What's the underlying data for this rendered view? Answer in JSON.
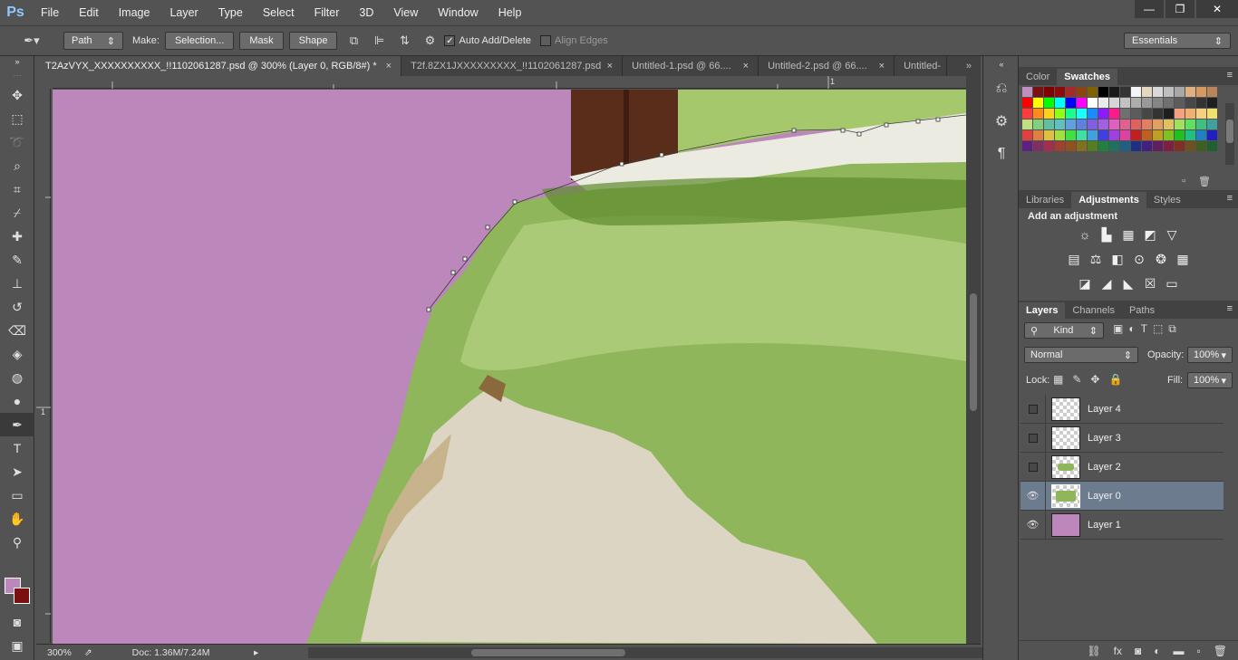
{
  "app": {
    "logo": "Ps"
  },
  "menu": [
    "File",
    "Edit",
    "Image",
    "Layer",
    "Type",
    "Select",
    "Filter",
    "3D",
    "View",
    "Window",
    "Help"
  ],
  "window_controls": {
    "minimize": "—",
    "restore": "❐",
    "close": "✕"
  },
  "options": {
    "mode_select": "Path",
    "make_label": "Make:",
    "selection_button": "Selection...",
    "mask_button": "Mask",
    "shape_button": "Shape",
    "auto_add_delete": "Auto Add/Delete",
    "align_edges": "Align Edges",
    "workspace": "Essentials"
  },
  "tabs": [
    {
      "title": "T2AzVYX_XXXXXXXXXX_!!1102061287.psd @ 300% (Layer 0, RGB/8#) *",
      "active": true
    },
    {
      "title": "T2f.8ZX1JXXXXXXXXX_!!1102061287.psd",
      "active": false
    },
    {
      "title": "Untitled-1.psd @ 66....",
      "active": false
    },
    {
      "title": "Untitled-2.psd @ 66....",
      "active": false
    },
    {
      "title": "Untitled-",
      "active": false
    }
  ],
  "rulers": {
    "top_mark": "1",
    "left_mark": "1"
  },
  "status": {
    "zoom": "300%",
    "doc": "Doc: 1.36M/7.24M"
  },
  "color_panel": {
    "tabs": [
      "Color",
      "Swatches"
    ],
    "active": "Swatches"
  },
  "adjust_panel": {
    "tabs": [
      "Libraries",
      "Adjustments",
      "Styles"
    ],
    "active": "Adjustments",
    "title": "Add an adjustment"
  },
  "layers_panel": {
    "tabs": [
      "Layers",
      "Channels",
      "Paths"
    ],
    "active": "Layers",
    "filter": "Kind",
    "blend_mode": "Normal",
    "opacity_label": "Opacity:",
    "opacity": "100%",
    "lock_label": "Lock:",
    "fill_label": "Fill:",
    "fill": "100%",
    "layers": [
      {
        "name": "Layer 4",
        "visible": false,
        "selected": false
      },
      {
        "name": "Layer 3",
        "visible": false,
        "selected": false
      },
      {
        "name": "Layer 2",
        "visible": false,
        "selected": false
      },
      {
        "name": "Layer 0",
        "visible": true,
        "selected": true
      },
      {
        "name": "Layer 1",
        "visible": true,
        "selected": false
      }
    ]
  },
  "colors": {
    "canvas_bg": "#bc87bb",
    "foreground": "#bc87bb",
    "background": "#7a1010",
    "blanket_green": "#8fb65a",
    "sheet_cream": "#ddd5c4"
  },
  "swatches": [
    [
      "#c08ec0",
      "#7a1010",
      "#800000",
      "#8b0a0a",
      "#a52a2a",
      "#8b4513",
      "#806000",
      "#000000",
      "#1a1a1a",
      "#333333",
      "#f5f5f5",
      "#e6d8c0",
      "#d9d9d9",
      "#bfbfbf",
      "#a8a8a8",
      "#e0b080",
      "#d49a60",
      "#b8865a"
    ],
    [
      "#ff0000",
      "#ffff00",
      "#00ff00",
      "#00ffff",
      "#0000ff",
      "#ff00ff",
      "#ffffff",
      "#ebebeb",
      "#d6d6d6",
      "#c2c2c2",
      "#adadad",
      "#999999",
      "#858585",
      "#707070",
      "#5c5c5c",
      "#474747",
      "#333333",
      "#1f1f1f"
    ],
    [
      "#ff3b3b",
      "#ff8c1a",
      "#ffd11a",
      "#8cff1a",
      "#1aff8c",
      "#1affff",
      "#1a8cff",
      "#8c1aff",
      "#ff1a8c",
      "#707070",
      "#5c5c5c",
      "#474747",
      "#333333",
      "#1f1f1f",
      "#f5a080",
      "#f0b070",
      "#f5d080",
      "#f0e070"
    ],
    [
      "#c0e080",
      "#80d080",
      "#60c0a0",
      "#60c0c0",
      "#60a0e0",
      "#6080e0",
      "#8060e0",
      "#a060e0",
      "#e060c0",
      "#e06090",
      "#e06060",
      "#e08060",
      "#e0a060",
      "#e0c060",
      "#a0e060",
      "#60e060",
      "#40c080",
      "#40a0a0"
    ],
    [
      "#e04040",
      "#e08040",
      "#e0c040",
      "#a0e040",
      "#40e040",
      "#40e0a0",
      "#40a0e0",
      "#4040e0",
      "#a040e0",
      "#e040a0",
      "#c02020",
      "#c06020",
      "#c0a020",
      "#80c020",
      "#20c020",
      "#20c080",
      "#2080c0",
      "#2020c0"
    ],
    [
      "#602080",
      "#803060",
      "#a03050",
      "#a04030",
      "#905020",
      "#807020",
      "#508020",
      "#208040",
      "#207060",
      "#206080",
      "#203080",
      "#402080",
      "#602060",
      "#802040",
      "#803020",
      "#705020",
      "#406020",
      "#206030"
    ]
  ]
}
